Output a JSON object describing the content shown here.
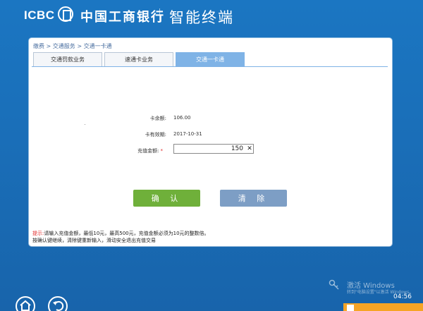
{
  "header": {
    "logo_text": "ICBC",
    "bank_name": "中国工商银行",
    "terminal_name": "智能终端"
  },
  "breadcrumb": "缴费 > 交通服务 > 交通一卡通",
  "tabs": [
    {
      "label": "交通罚款业务",
      "active": false
    },
    {
      "label": "速通卡业务",
      "active": false
    },
    {
      "label": "交通一卡通",
      "active": true
    }
  ],
  "fields": {
    "balance_label": "卡余额:",
    "balance_value": "106.00",
    "expiry_label": "卡有效期:",
    "expiry_value": "2017-10-31",
    "amount_label": "充值金额:",
    "amount_required": "*",
    "amount_value": "150",
    "amount_clear": "✕"
  },
  "buttons": {
    "confirm": "确 认",
    "clear": "清 除"
  },
  "tips": {
    "label": "提示:",
    "line1": "请输入充值金额，最低10元，最高500元，充值金额必须为10元的整数倍。",
    "line2": "按确认键继续，清除键重新输入，滑动安全退出充值交易"
  },
  "watermark": {
    "title": "激活 Windows",
    "subtitle": "转到\"电脑设置\"以激活 Windows。"
  },
  "clock": "04:56",
  "colors": {
    "background": "#1a6fb9",
    "tab_active": "#7fb3e6",
    "confirm_button": "#6fb03a",
    "clear_button": "#7d9ec5",
    "required": "#e02b2b"
  }
}
